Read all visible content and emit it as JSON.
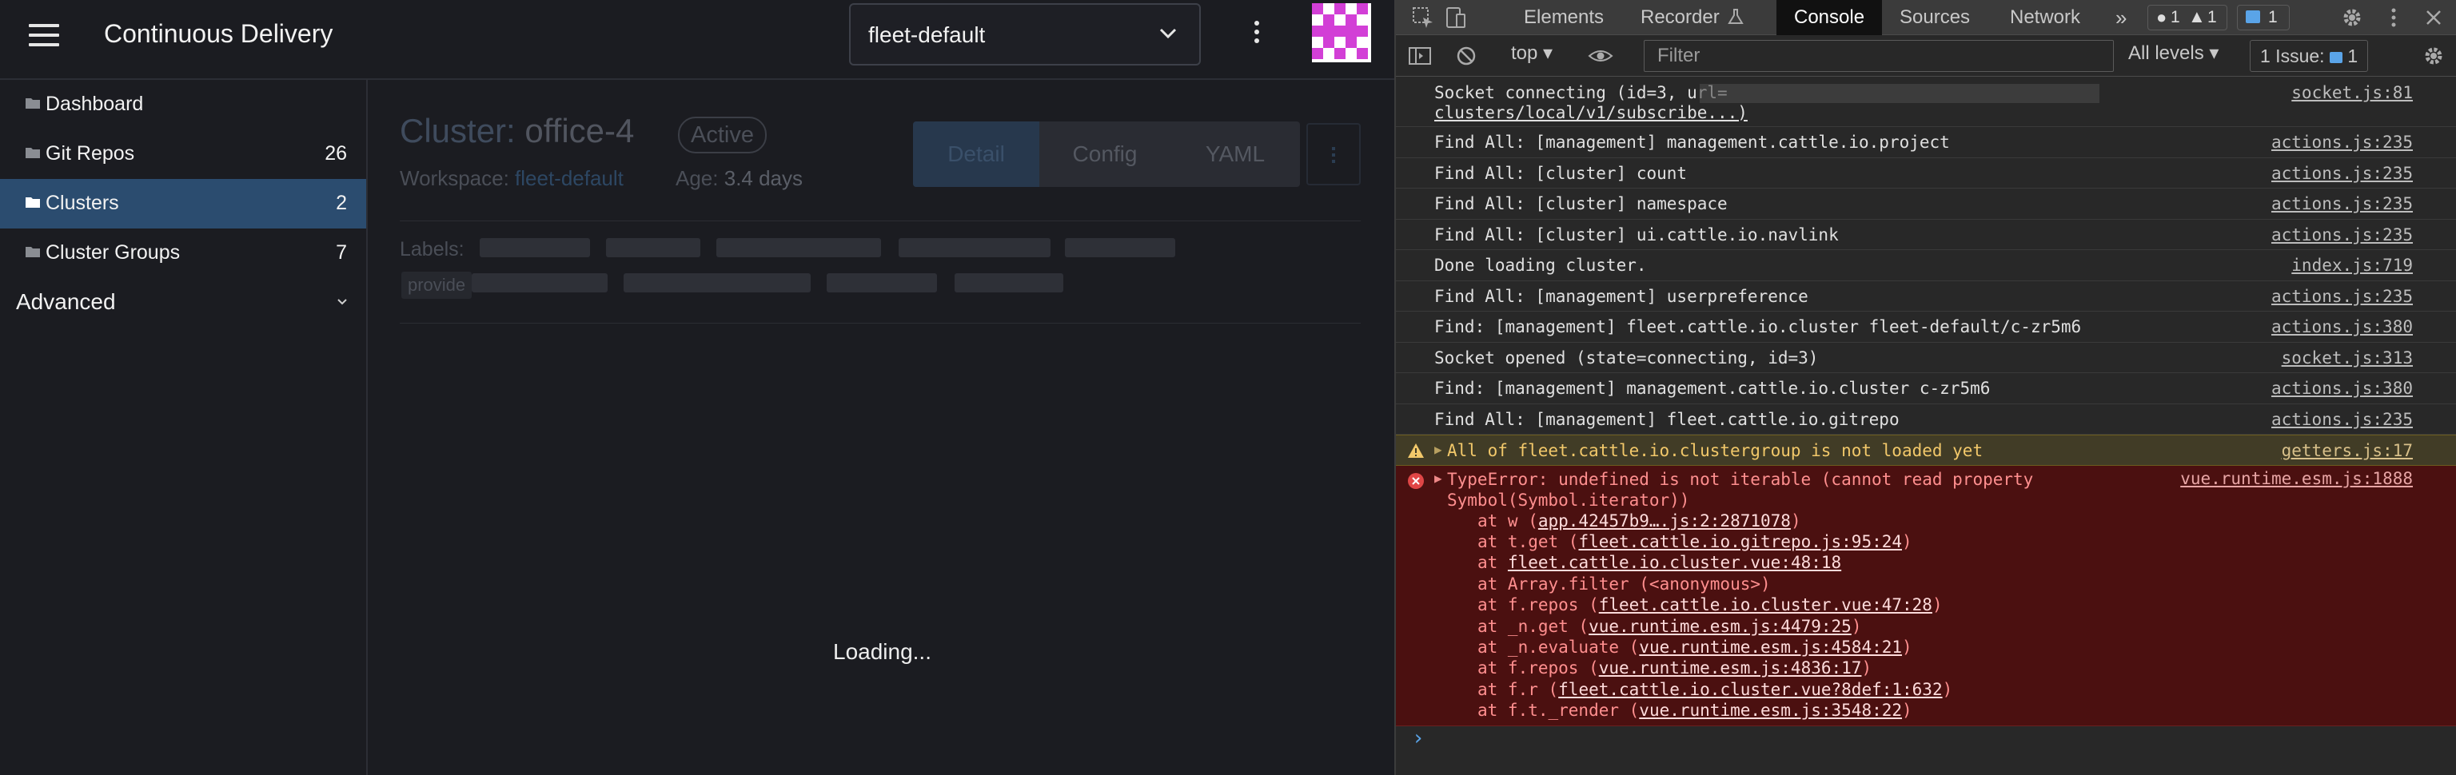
{
  "app": {
    "title": "Continuous Delivery",
    "workspace": "fleet-default",
    "nav": [
      {
        "label": "Dashboard",
        "count": ""
      },
      {
        "label": "Git Repos",
        "count": "26"
      },
      {
        "label": "Clusters",
        "count": "2",
        "active": true
      },
      {
        "label": "Cluster Groups",
        "count": "7"
      }
    ],
    "advanced_label": "Advanced"
  },
  "main": {
    "title_prefix": "Cluster:",
    "cluster_name": "office-4",
    "state_badge": "Active",
    "workspace_label": "Workspace:",
    "workspace_value": "fleet-default",
    "age_label": "Age:",
    "age_value": "3.4 days",
    "tabs": [
      "Detail",
      "Config",
      "YAML"
    ],
    "labels_label": "Labels:",
    "label_chip": "provide",
    "loading": "Loading..."
  },
  "devtools": {
    "tabs": [
      "Elements",
      "Recorder",
      "Console",
      "Sources",
      "Network"
    ],
    "active_tab": "Console",
    "badges": {
      "errors": "1",
      "warnings": "1",
      "messages": "1"
    },
    "context": "top",
    "filter_placeholder": "Filter",
    "levels": "All levels",
    "issues": "1 Issue:",
    "issues_count": "1",
    "logs": [
      {
        "msg": "Socket connecting (id=3, url=",
        "msg2": "clusters/local/v1/subscribe...)",
        "src": "socket.js:81"
      },
      {
        "msg": "Find All: [management] management.cattle.io.project",
        "src": "actions.js:235"
      },
      {
        "msg": "Find All: [cluster] count",
        "src": "actions.js:235"
      },
      {
        "msg": "Find All: [cluster] namespace",
        "src": "actions.js:235"
      },
      {
        "msg": "Find All: [cluster] ui.cattle.io.navlink",
        "src": "actions.js:235"
      },
      {
        "msg": "Done loading cluster.",
        "src": "index.js:719"
      },
      {
        "msg": "Find All: [management] userpreference",
        "src": "actions.js:235"
      },
      {
        "msg": "Find: [management] fleet.cattle.io.cluster fleet-default/c-zr5m6",
        "src": "actions.js:380"
      },
      {
        "msg": "Socket opened (state=connecting, id=3)",
        "src": "socket.js:313"
      },
      {
        "msg": "Find: [management] management.cattle.io.cluster c-zr5m6",
        "src": "actions.js:380"
      },
      {
        "msg": "Find All: [management] fleet.cattle.io.gitrepo",
        "src": "actions.js:235"
      }
    ],
    "warning": {
      "msg": "All of fleet.cattle.io.clustergroup is not loaded yet",
      "src": "getters.js:17"
    },
    "error": {
      "msg": "TypeError: undefined is not iterable (cannot read property\nSymbol(Symbol.iterator))",
      "src": "vue.runtime.esm.js:1888",
      "stack": [
        {
          "fn": "at w (",
          "loc": "app.42457b9….js:2:2871078",
          "end": ")"
        },
        {
          "fn": "at t.get (",
          "loc": "fleet.cattle.io.gitrepo.js:95:24",
          "end": ")"
        },
        {
          "fn": "at ",
          "loc": "fleet.cattle.io.cluster.vue:48:18",
          "end": ""
        },
        {
          "fn": "at Array.filter (<anonymous>)",
          "loc": "",
          "end": ""
        },
        {
          "fn": "at f.repos (",
          "loc": "fleet.cattle.io.cluster.vue:47:28",
          "end": ")"
        },
        {
          "fn": "at _n.get (",
          "loc": "vue.runtime.esm.js:4479:25",
          "end": ")"
        },
        {
          "fn": "at _n.evaluate (",
          "loc": "vue.runtime.esm.js:4584:21",
          "end": ")"
        },
        {
          "fn": "at f.repos (",
          "loc": "vue.runtime.esm.js:4836:17",
          "end": ")"
        },
        {
          "fn": "at f.r (",
          "loc": "fleet.cattle.io.cluster.vue?8def:1:632",
          "end": ")"
        },
        {
          "fn": "at f.t._render (",
          "loc": "vue.runtime.esm.js:3548:22",
          "end": ")"
        }
      ]
    },
    "prompt": "›"
  },
  "colors": {
    "accent": "#2b4c6f",
    "avatar": "#d23fd6",
    "error_bg": "#4b1010",
    "warn_bg": "#413c26"
  },
  "icons": [
    "hamburger-icon",
    "chevron-down-icon",
    "kebab-icon",
    "folder-icon",
    "inspect-icon",
    "device-icon",
    "settings-icon",
    "more-icon",
    "close-icon",
    "sidebar-icon",
    "clear-icon",
    "eye-icon",
    "warning-icon",
    "error-icon",
    "chat-icon"
  ]
}
